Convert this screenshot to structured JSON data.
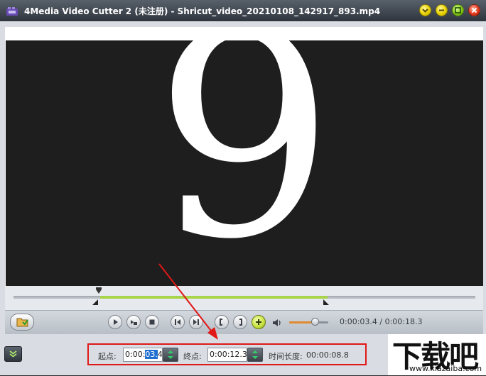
{
  "window": {
    "title": "4Media Video Cutter 2 (未注册) - Shricut_video_20210108_142917_893.mp4",
    "controls": [
      "minimize-to-tray",
      "minimize",
      "maximize",
      "close"
    ]
  },
  "video": {
    "frame_text": "9"
  },
  "timeline": {
    "selection_start_fraction": 0.19,
    "selection_end_fraction": 0.69
  },
  "playback": {
    "buttons": [
      "play",
      "snapshot",
      "stop",
      "previous",
      "next",
      "mark-in",
      "mark-out",
      "add-segment"
    ],
    "time_readout": "0:00:03.4 / 0:00:18.3",
    "volume_fraction": 0.65
  },
  "range": {
    "start_label": "起点:",
    "start_value_prefix": "0:00:",
    "start_value_selected": "03.",
    "start_value_suffix": "4",
    "end_label": "终点:",
    "end_value": "0:00:12.3",
    "duration_label": "时间长度:",
    "duration_value": "00:00:08.8"
  },
  "watermark": {
    "main": "下载吧",
    "sub": "www.xiazaiba.com"
  },
  "colors": {
    "highlight_box": "#e01818",
    "selection_bar": "#a8d44a",
    "text_selection": "#1f6fd1"
  }
}
